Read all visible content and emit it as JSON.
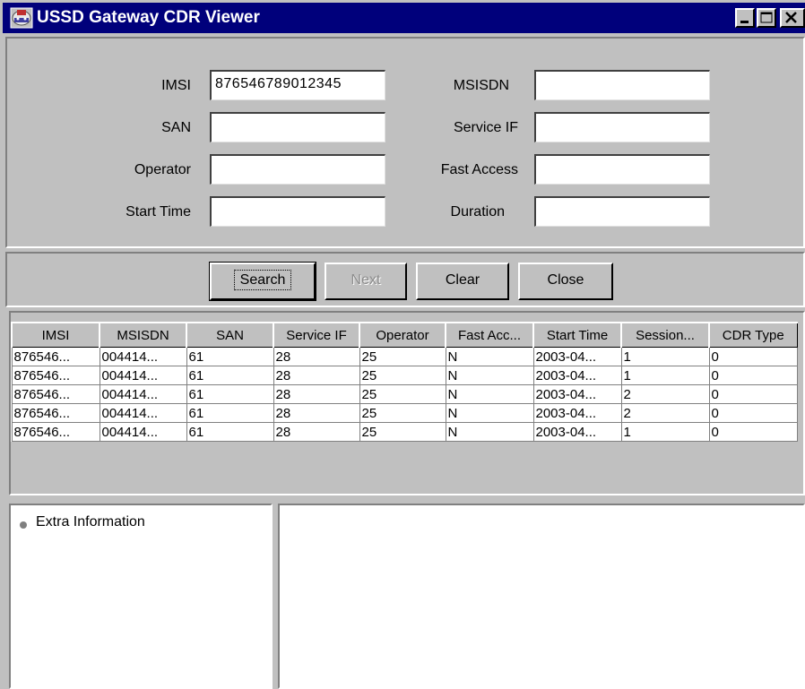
{
  "window": {
    "title": "USSD Gateway CDR Viewer",
    "controls": {
      "minimize": "_",
      "maximize": "□",
      "close": "×"
    }
  },
  "form": {
    "imsi": {
      "label": "IMSI",
      "value": "876546789012345"
    },
    "msisdn": {
      "label": "MSISDN",
      "value": ""
    },
    "san": {
      "label": "SAN",
      "value": ""
    },
    "service_if": {
      "label": "Service IF",
      "value": ""
    },
    "operator": {
      "label": "Operator",
      "value": ""
    },
    "fast_access": {
      "label": "Fast Access",
      "value": ""
    },
    "start_time": {
      "label": "Start Time",
      "value": ""
    },
    "duration": {
      "label": "Duration",
      "value": ""
    }
  },
  "buttons": {
    "search": "Search",
    "next": "Next",
    "clear": "Clear",
    "close": "Close"
  },
  "table": {
    "columns": [
      "IMSI",
      "MSISDN",
      "SAN",
      "Service IF",
      "Operator",
      "Fast Acc...",
      "Start Time",
      "Session...",
      "CDR Type"
    ],
    "rows": [
      [
        "876546...",
        "004414...",
        "61",
        "28",
        "25",
        "N",
        "2003-04...",
        "1",
        "0"
      ],
      [
        "876546...",
        "004414...",
        "61",
        "28",
        "25",
        "N",
        "2003-04...",
        "1",
        "0"
      ],
      [
        "876546...",
        "004414...",
        "61",
        "28",
        "25",
        "N",
        "2003-04...",
        "2",
        "0"
      ],
      [
        "876546...",
        "004414...",
        "61",
        "28",
        "25",
        "N",
        "2003-04...",
        "2",
        "0"
      ],
      [
        "876546...",
        "004414...",
        "61",
        "28",
        "25",
        "N",
        "2003-04...",
        "1",
        "0"
      ]
    ]
  },
  "tree": {
    "root_label": "Extra Information",
    "bullet_icon": "bullet-icon"
  },
  "colors": {
    "titlebar": "#00007b",
    "face": "#c0c0c0"
  }
}
